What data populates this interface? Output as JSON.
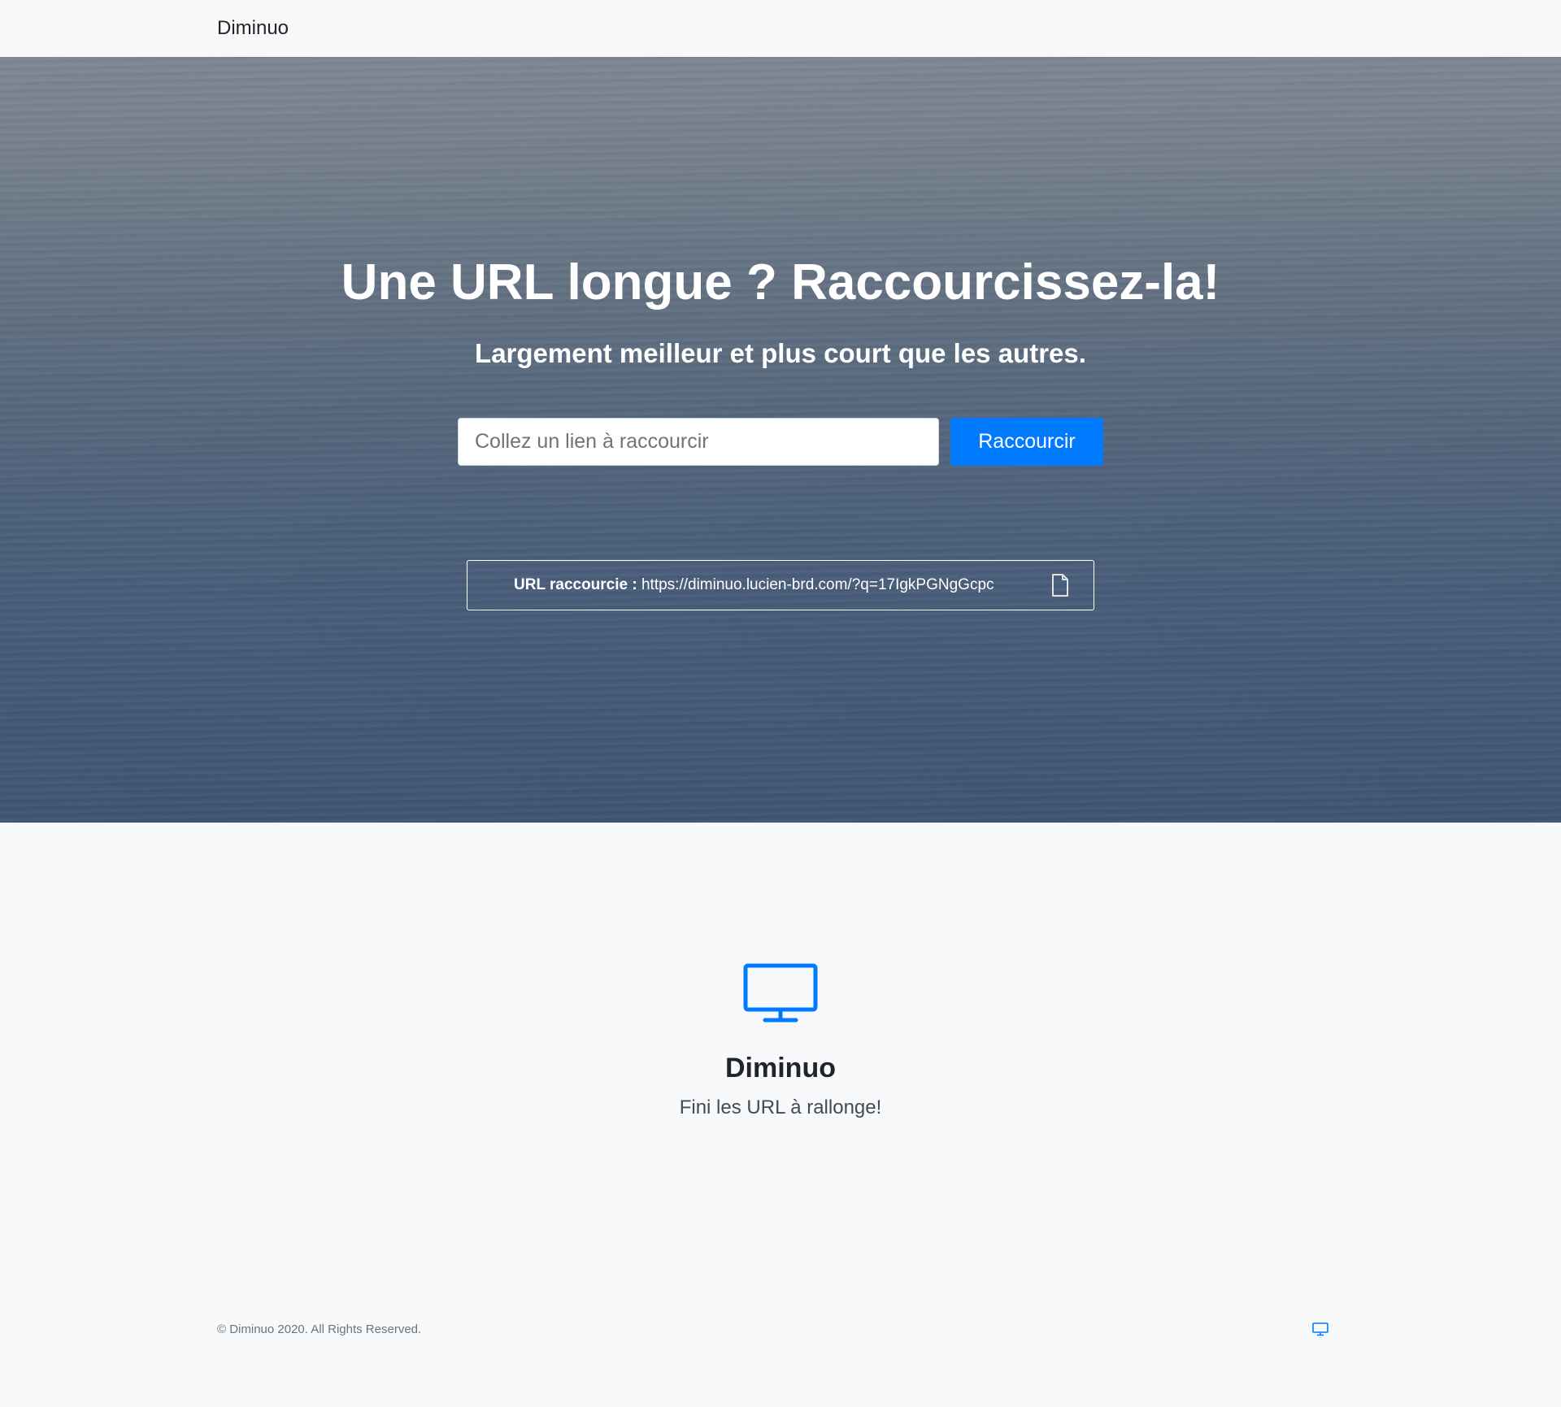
{
  "navbar": {
    "brand": "Diminuo"
  },
  "hero": {
    "title": "Une URL longue ? Raccourcissez-la!",
    "subtitle": "Largement meilleur et plus court que les autres.",
    "input": {
      "placeholder": "Collez un lien à raccourcir",
      "value": ""
    },
    "submit_label": "Raccourcir",
    "result": {
      "label": "URL raccourcie :",
      "url": "https://diminuo.lucien-brd.com/?q=17IgkPGNgGcpc",
      "copy_icon": "file-icon"
    }
  },
  "feature": {
    "icon": "desktop-icon",
    "title": "Diminuo",
    "text": "Fini les URL à rallonge!"
  },
  "footer": {
    "copyright": "© Diminuo 2020. All Rights Reserved.",
    "icon": "desktop-icon"
  },
  "colors": {
    "accent": "#007bff",
    "page_background": "#f8f9fa",
    "text": "#212529",
    "hero_text": "#ffffff"
  }
}
